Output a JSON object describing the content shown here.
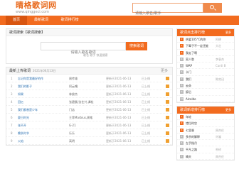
{
  "site": {
    "title": "晴格歌词网",
    "domain": "www.qinggeci.com"
  },
  "search_top": {
    "placeholder": "请输入歌名/歌手"
  },
  "nav": {
    "items": [
      {
        "label": "首页",
        "active": true
      },
      {
        "label": "最新歌词",
        "active": false
      },
      {
        "label": "歌词排行榜",
        "active": false
      }
    ]
  },
  "search_box": {
    "title": "歌词搜索【歌词搜索】",
    "input_placeholder": "请输入歌名歌词",
    "button_label": "搜索歌词",
    "hint": "歌名 歌手 快速搜索"
  },
  "latest": {
    "title": "最新上传歌词",
    "subtitle": "2021年06月13日",
    "more": "更多",
    "rows": [
      {
        "num": "1",
        "song": "忘记你是我最好的作",
        "singer": "周传雄",
        "date": "更新于2021-06-13",
        "status": "已上线"
      },
      {
        "num": "2",
        "song": "我们的影子",
        "singer": "阿云嘎",
        "date": "更新于2021-06-13",
        "status": "已上线"
      },
      {
        "num": "3",
        "song": "如果",
        "singer": "林俊杰",
        "date": "更新于2021-06-13",
        "status": "已上线"
      },
      {
        "num": "4",
        "song": "回忆",
        "singer": "张碧晨,张艺兴,谭松",
        "date": "更新于2021-06-13",
        "status": "已上线"
      },
      {
        "num": "5",
        "song": "我们都曾是少年",
        "singer": "门店",
        "date": "更新于2021-06-13",
        "status": "已上线"
      },
      {
        "num": "6",
        "song": "夏日时光",
        "singer": "王菲Marbius,周笔",
        "date": "更新于2021-06-13",
        "status": "已上线"
      },
      {
        "num": "7",
        "song": "张不开",
        "singer": "G-21",
        "date": "更新于2021-06-13",
        "status": "已上线"
      },
      {
        "num": "8",
        "song": "晚秋时节",
        "singer": "乐乐",
        "date": "更新于2021-06-13",
        "status": "已上线"
      },
      {
        "num": "9",
        "song": "火焰",
        "singer": "高明",
        "date": "更新于2021-06-13",
        "status": "已上线"
      }
    ]
  },
  "hot_rank": {
    "title": "歌词点击排行榜",
    "more": "更多",
    "rows": [
      {
        "rank": "1",
        "name": "热爱105°C的你",
        "artist": "阿肆"
      },
      {
        "rank": "2",
        "name": "下辈子不一定还能",
        "artist": "大壮"
      },
      {
        "rank": "3",
        "name": "我走了啊",
        "artist": ""
      },
      {
        "rank": "4",
        "name": "离人愁",
        "artist": "李袁杰"
      },
      {
        "rank": "5",
        "name": "WAP",
        "artist": "Cardi B"
      },
      {
        "rank": "6",
        "name": "卡门",
        "artist": ""
      },
      {
        "rank": "7",
        "name": "我们",
        "artist": "陈奕迅"
      },
      {
        "rank": "8",
        "name": "云朵",
        "artist": ""
      },
      {
        "rank": "9",
        "name": "醉后",
        "artist": ""
      },
      {
        "rank": "10",
        "name": "Alcalde",
        "artist": ""
      }
    ]
  },
  "new_rank": {
    "title": "歌词新增排行榜",
    "more": "更多",
    "rows": [
      {
        "rank": "1",
        "name": "年轮",
        "artist": ""
      },
      {
        "rank": "2",
        "name": "错位时空",
        "artist": ""
      },
      {
        "rank": "3",
        "name": "七里香",
        "artist": "周杰伦"
      },
      {
        "rank": "4",
        "name": "多余的解释",
        "artist": "许嵩"
      },
      {
        "rank": "5",
        "name": "左手指月",
        "artist": ""
      },
      {
        "rank": "6",
        "name": "平凡之路",
        "artist": "朴树"
      },
      {
        "rank": "7",
        "name": "晴天",
        "artist": "周杰伦"
      }
    ]
  }
}
